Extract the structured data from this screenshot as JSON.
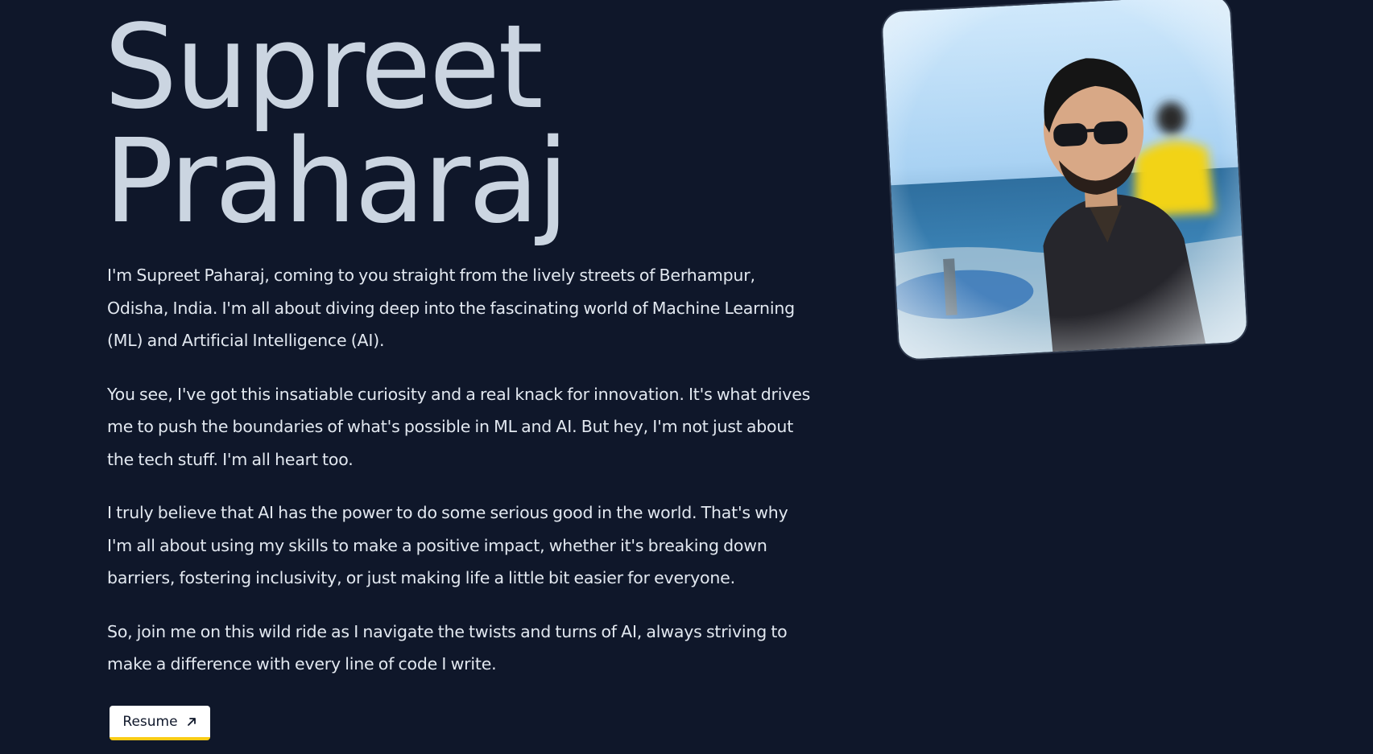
{
  "profile": {
    "first_name": "Supreet",
    "last_name": "Praharaj",
    "photo_alt": "Supreet Praharaj"
  },
  "bio": {
    "paragraphs": [
      "I'm Supreet Paharaj, coming to you straight from the lively streets of Berhampur, Odisha, India. I'm all about diving deep into the fascinating world of Machine Learning (ML) and Artificial Intelligence (AI).",
      "You see, I've got this insatiable curiosity and a real knack for innovation. It's what drives me to push the boundaries of what's possible in ML and AI. But hey, I'm not just about the tech stuff. I'm all heart too.",
      "I truly believe that AI has the power to do some serious good in the world. That's why I'm all about using my skills to make a positive impact, whether it's breaking down barriers, fostering inclusivity, or just making life a little bit easier for everyone.",
      "So, join me on this wild ride as I navigate the twists and turns of AI, always striving to make a difference with every line of code I write."
    ]
  },
  "resume_button": {
    "label": "Resume",
    "icon": "arrow-up-right-icon"
  },
  "colors": {
    "background": "#0f172a",
    "heading": "#cbd5e1",
    "body_text": "#e2e8f0",
    "button_bg": "#ffffff",
    "button_accent": "#facc15"
  }
}
